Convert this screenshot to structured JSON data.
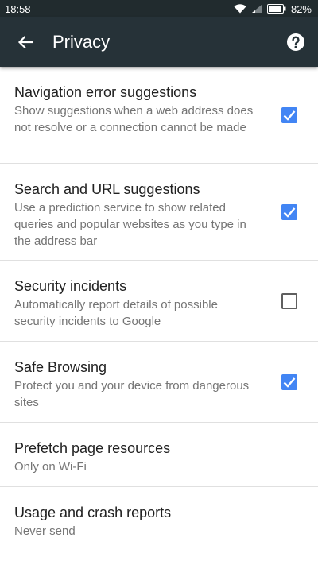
{
  "status_bar": {
    "time": "18:58",
    "battery": "82%"
  },
  "toolbar": {
    "title": "Privacy",
    "back_icon": "arrow-back-icon",
    "help_icon": "help-icon"
  },
  "colors": {
    "status_bar_bg": "#212b2e",
    "toolbar_bg": "#263238",
    "checkbox_accent": "#4285f4",
    "summary_text": "#757575"
  },
  "settings": [
    {
      "title": "Navigation error suggestions",
      "summary": "Show suggestions when a web address does not resolve or a connection cannot be made",
      "checked": true
    },
    {
      "title": "Search and URL suggestions",
      "summary": "Use a prediction service to show related queries and popular websites as you type in the address bar",
      "checked": true
    },
    {
      "title": "Security incidents",
      "summary": "Automatically report details of possible security incidents to Google",
      "checked": false
    },
    {
      "title": "Safe Browsing",
      "summary": "Protect you and your device from dangerous sites",
      "checked": true
    },
    {
      "title": "Prefetch page resources",
      "summary": "Only on Wi-Fi"
    },
    {
      "title": "Usage and crash reports",
      "summary": "Never send"
    }
  ]
}
